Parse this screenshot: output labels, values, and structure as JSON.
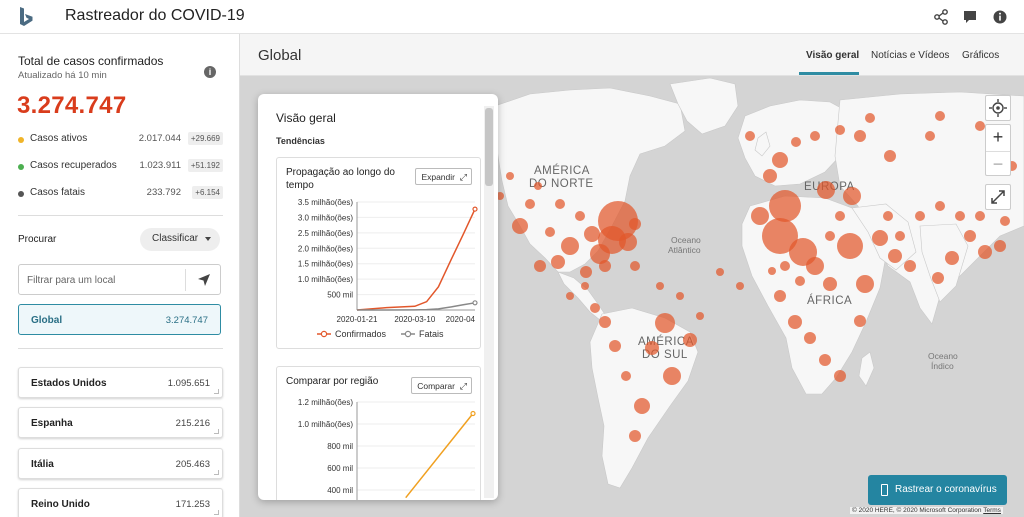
{
  "header": {
    "title": "Rastreador do COVID-19",
    "icons": [
      "share-icon",
      "feedback-icon",
      "info-icon"
    ]
  },
  "left": {
    "title": "Total de casos confirmados",
    "updated": "Atualizado há 10 min",
    "total": "3.274.747",
    "stats": [
      {
        "label": "Casos ativos",
        "value": "2.017.044",
        "delta": "+29.669",
        "color": "#f0b429"
      },
      {
        "label": "Casos recuperados",
        "value": "1.023.911",
        "delta": "+51.192",
        "color": "#4caf50"
      },
      {
        "label": "Casos fatais",
        "value": "233.792",
        "delta": "+6.154",
        "color": "#555555"
      }
    ],
    "search_label": "Procurar",
    "sort_label": "Classificar",
    "filter_placeholder": "Filtrar para um local",
    "global": {
      "name": "Global",
      "value": "3.274.747"
    },
    "locations": [
      {
        "name": "Estados Unidos",
        "value": "1.095.651"
      },
      {
        "name": "Espanha",
        "value": "215.216"
      },
      {
        "name": "Itália",
        "value": "205.463"
      },
      {
        "name": "Reino Unido",
        "value": "171.253"
      }
    ]
  },
  "main": {
    "title": "Global",
    "tabs": [
      "Visão geral",
      "Notícias e Vídeos",
      "Gráficos"
    ],
    "active_tab": "Visão geral",
    "map_labels": {
      "na": [
        "AMÉRICA",
        "DO NORTE"
      ],
      "eu": "EUROPA",
      "af": "ÁFRICA",
      "sa": [
        "AMÉRICA",
        "DO SUL"
      ],
      "atl": [
        "Oceano",
        "Atlântico"
      ],
      "ind": [
        "Oceano",
        "Índico"
      ]
    },
    "track_button": "Rastrear o coronavírus",
    "copyright": "© 2020 HERE, © 2020 Microsoft Corporation",
    "terms": "Terms",
    "accent": "#2e8ca3"
  },
  "overview": {
    "title": "Visão geral",
    "subtitle": "Tendências",
    "card1_title": [
      "Propagação ao longo do",
      "tempo"
    ],
    "card1_button": "Expandir",
    "card2_title": "Comparar por região",
    "card2_button": "Comparar"
  },
  "chart_data": [
    {
      "type": "line",
      "title": "Propagação ao longo do tempo",
      "x": [
        "2020-01-21",
        "2020-02-15",
        "2020-03-10",
        "2020-03-20",
        "2020-03-30",
        "2020-04-10",
        "2020-04-20",
        "2020-04-30"
      ],
      "x_tick_labels": [
        "2020-01-21",
        "2020-03-10",
        "2020-04"
      ],
      "y_tick_labels": [
        "500 mil",
        "1.0 milhão(ões)",
        "1.5 milhão(ões)",
        "2.0 milhão(ões)",
        "2.5 milhão(ões)",
        "3.0 milhão(ões)",
        "3.5 milhão(ões)"
      ],
      "ylim": [
        0,
        3500000
      ],
      "series": [
        {
          "name": "Confirmados",
          "color": "#e2572b",
          "values": [
            300,
            75000,
            120000,
            270000,
            750000,
            1650000,
            2450000,
            3270000
          ]
        },
        {
          "name": "Fatais",
          "color": "#888888",
          "values": [
            10,
            2000,
            4300,
            11000,
            35000,
            100000,
            170000,
            233000
          ]
        }
      ]
    },
    {
      "type": "line",
      "title": "Comparar por região",
      "y_tick_labels": [
        "400 mil",
        "600 mil",
        "800 mil",
        "1.0 milhão(ões)",
        "1.2 milhão(ões)"
      ],
      "ylim": [
        400000,
        1200000
      ],
      "series": [
        {
          "color": "#f0a020",
          "x": [
            0.42,
            1.0
          ],
          "values": [
            330000,
            1095651
          ]
        }
      ]
    }
  ]
}
